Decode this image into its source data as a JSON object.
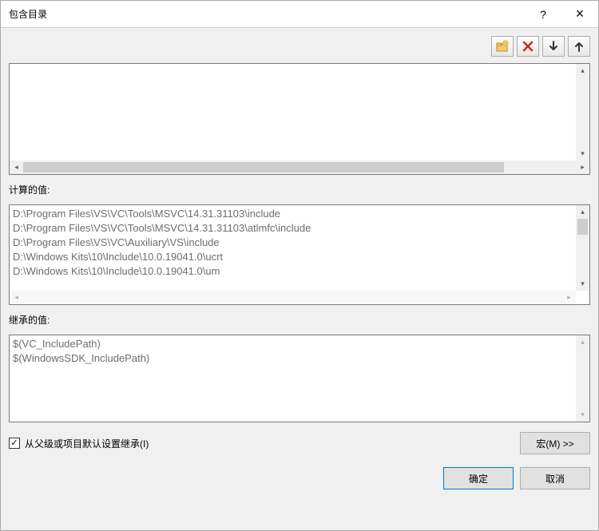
{
  "window": {
    "title": "包含目录",
    "help": "?",
    "close": "×"
  },
  "toolbar": {
    "new_folder_icon": "folder-new-icon",
    "delete_icon": "delete-x-icon",
    "move_down_icon": "arrow-down-icon",
    "move_up_icon": "arrow-up-icon"
  },
  "computed": {
    "label": "计算的值:",
    "items": [
      "D:\\Program Files\\VS\\VC\\Tools\\MSVC\\14.31.31103\\include",
      "D:\\Program Files\\VS\\VC\\Tools\\MSVC\\14.31.31103\\atlmfc\\include",
      "D:\\Program Files\\VS\\VC\\Auxiliary\\VS\\include",
      "D:\\Windows Kits\\10\\Include\\10.0.19041.0\\ucrt",
      "D:\\Windows Kits\\10\\Include\\10.0.19041.0\\um"
    ]
  },
  "inherited": {
    "label": "继承的值:",
    "items": [
      "$(VC_IncludePath)",
      "$(WindowsSDK_IncludePath)"
    ]
  },
  "checkbox": {
    "label": "从父级或项目默认设置继承(I)",
    "checked": true,
    "mark": "✓"
  },
  "buttons": {
    "macros": "宏(M) >>",
    "ok": "确定",
    "cancel": "取消"
  }
}
